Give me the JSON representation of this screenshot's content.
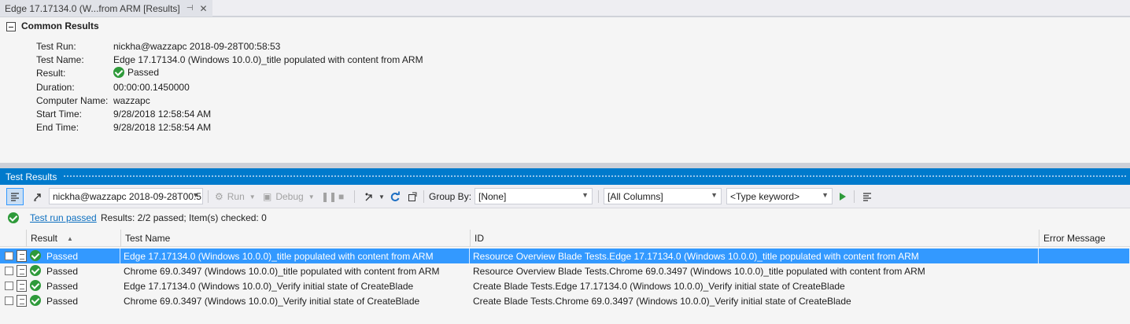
{
  "tab": {
    "title": "Edge 17.17134.0 (W...from ARM [Results]",
    "pin": "⊣",
    "close": "✕"
  },
  "common": {
    "title": "Common Results",
    "fields": [
      {
        "label": "Test Run:",
        "value": "nickha@wazzapc 2018-09-28T00:58:53"
      },
      {
        "label": "Test Name:",
        "value": "Edge 17.17134.0 (Windows 10.0.0)_title populated with content from ARM"
      },
      {
        "label": "Result:",
        "value": "Passed"
      },
      {
        "label": "Duration:",
        "value": "00:00:00.1450000"
      },
      {
        "label": "Computer Name:",
        "value": "wazzapc"
      },
      {
        "label": "Start Time:",
        "value": "9/28/2018 12:58:54 AM"
      },
      {
        "label": "End Time:",
        "value": "9/28/2018 12:58:54 AM"
      }
    ]
  },
  "panel": {
    "title": "Test Results"
  },
  "toolbar": {
    "run_select": "nickha@wazzapc 2018-09-28T00:5",
    "run_label": "Run",
    "debug_label": "Debug",
    "group_by_label": "Group By:",
    "group_by_value": "[None]",
    "columns_value": "[All Columns]",
    "keyword_placeholder": "<Type keyword>"
  },
  "status": {
    "link": "Test run passed",
    "text": "Results: 2/2 passed;  Item(s) checked: 0"
  },
  "grid": {
    "headers": {
      "result": "Result",
      "test_name": "Test Name",
      "id": "ID",
      "error": "Error Message"
    },
    "rows": [
      {
        "result": "Passed",
        "test_name": "Edge 17.17134.0 (Windows 10.0.0)_title populated with content from ARM",
        "id": "Resource Overview Blade Tests.Edge 17.17134.0 (Windows 10.0.0)_title populated with content from ARM",
        "error": ""
      },
      {
        "result": "Passed",
        "test_name": "Chrome 69.0.3497 (Windows 10.0.0)_title populated with content from ARM",
        "id": "Resource Overview Blade Tests.Chrome 69.0.3497 (Windows 10.0.0)_title populated with content from ARM",
        "error": ""
      },
      {
        "result": "Passed",
        "test_name": "Edge 17.17134.0 (Windows 10.0.0)_Verify initial state of CreateBlade",
        "id": "Create Blade Tests.Edge 17.17134.0 (Windows 10.0.0)_Verify initial state of CreateBlade",
        "error": ""
      },
      {
        "result": "Passed",
        "test_name": "Chrome 69.0.3497 (Windows 10.0.0)_Verify initial state of CreateBlade",
        "id": "Create Blade Tests.Chrome 69.0.3497 (Windows 10.0.0)_Verify initial state of CreateBlade",
        "error": ""
      }
    ]
  },
  "colors": {
    "accent": "#007acc",
    "selection": "#3399ff",
    "pass": "#2e9a3a",
    "link": "#0e70c0"
  }
}
